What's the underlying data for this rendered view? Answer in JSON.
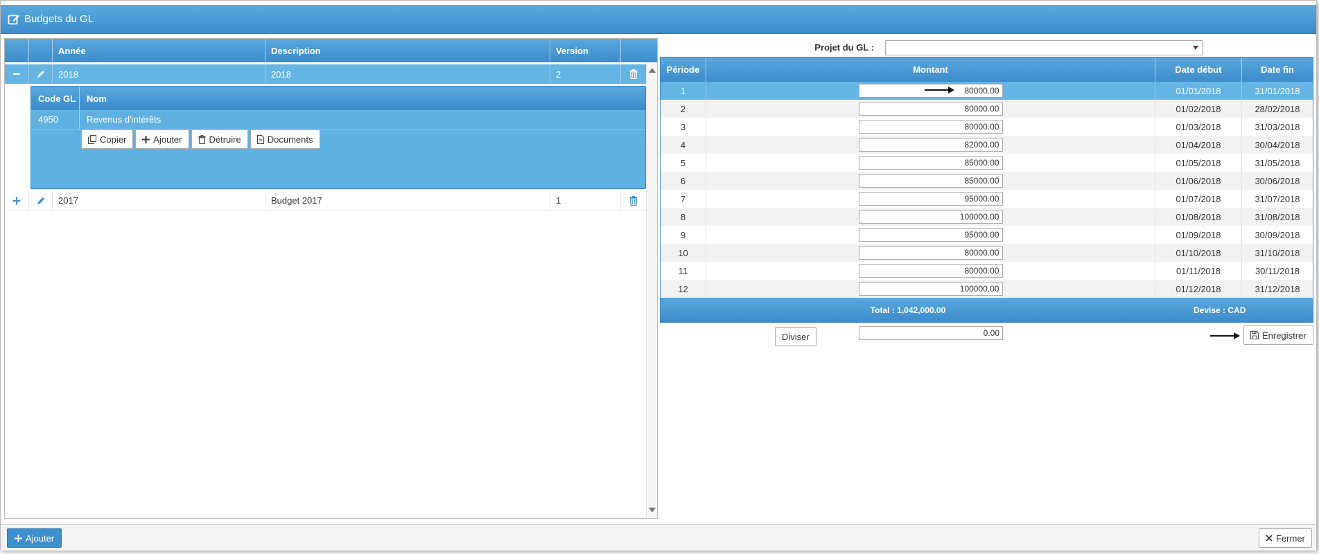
{
  "window": {
    "title": "Budgets du GL"
  },
  "budgets": {
    "headers": {
      "year": "Année",
      "description": "Description",
      "version": "Version"
    },
    "rows": [
      {
        "year": "2018",
        "description": "2018",
        "version": "2",
        "expanded": true
      },
      {
        "year": "2017",
        "description": "Budget 2017",
        "version": "1",
        "expanded": false
      }
    ],
    "detail": {
      "headers": {
        "code": "Code GL",
        "name": "Nom"
      },
      "rows": [
        {
          "code": "4950",
          "name": "Revenus d'intérêts"
        }
      ],
      "buttons": {
        "copy": "Copier",
        "add": "Ajouter",
        "destroy": "Détruire",
        "documents": "Documents"
      }
    }
  },
  "project": {
    "label": "Projet du GL :",
    "value": ""
  },
  "periods": {
    "headers": {
      "period": "Période",
      "amount": "Montant",
      "start": "Date début",
      "end": "Date fin"
    },
    "rows": [
      {
        "period": "1",
        "amount": "80000.00",
        "start": "01/01/2018",
        "end": "31/01/2018"
      },
      {
        "period": "2",
        "amount": "80000.00",
        "start": "01/02/2018",
        "end": "28/02/2018"
      },
      {
        "period": "3",
        "amount": "80000.00",
        "start": "01/03/2018",
        "end": "31/03/2018"
      },
      {
        "period": "4",
        "amount": "82000.00",
        "start": "01/04/2018",
        "end": "30/04/2018"
      },
      {
        "period": "5",
        "amount": "85000.00",
        "start": "01/05/2018",
        "end": "31/05/2018"
      },
      {
        "period": "6",
        "amount": "85000.00",
        "start": "01/06/2018",
        "end": "30/06/2018"
      },
      {
        "period": "7",
        "amount": "95000.00",
        "start": "01/07/2018",
        "end": "31/07/2018"
      },
      {
        "period": "8",
        "amount": "100000.00",
        "start": "01/08/2018",
        "end": "31/08/2018"
      },
      {
        "period": "9",
        "amount": "95000.00",
        "start": "01/09/2018",
        "end": "30/09/2018"
      },
      {
        "period": "10",
        "amount": "80000.00",
        "start": "01/10/2018",
        "end": "31/10/2018"
      },
      {
        "period": "11",
        "amount": "80000.00",
        "start": "01/11/2018",
        "end": "30/11/2018"
      },
      {
        "period": "12",
        "amount": "100000.00",
        "start": "01/12/2018",
        "end": "31/12/2018"
      }
    ],
    "total": "Total : 1,042,000.00",
    "currency": "Devise :  CAD"
  },
  "actions": {
    "divide_label": "Diviser",
    "divide_value": "0.00",
    "save_label": "Enregistrer",
    "add_label": "Ajouter",
    "close_label": "Fermer"
  },
  "colors": {
    "header": "#3c8bcb",
    "selected": "#64b4e4",
    "stripe": "#f2f2f2"
  },
  "icons": {
    "title": "edit-icon",
    "expand": "minus-icon",
    "collapse": "plus-icon",
    "edit": "pencil-icon",
    "delete": "trash-icon",
    "copy": "copy-icon",
    "add": "plus-icon",
    "documents": "document-icon",
    "save": "save-icon",
    "close": "close-icon",
    "arrow": "arrow-right-icon"
  }
}
